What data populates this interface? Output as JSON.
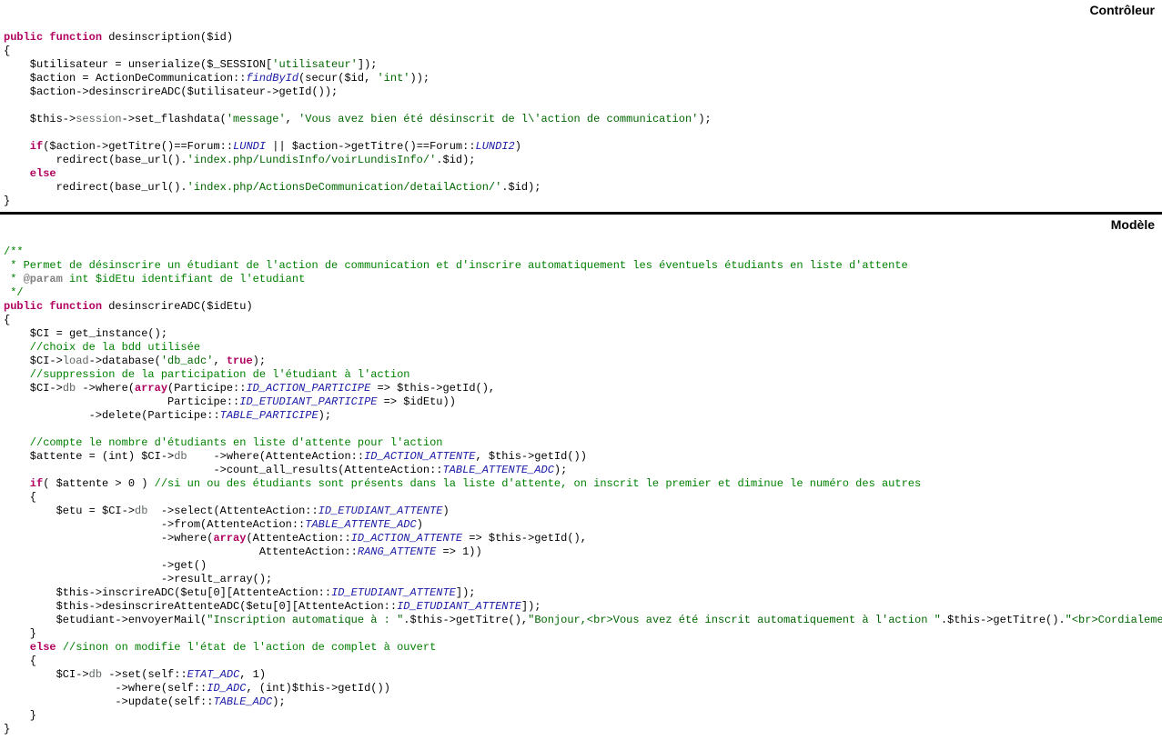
{
  "labels": {
    "controller": "Contrôleur",
    "model": "Modèle"
  },
  "controller": {
    "l01a": "public",
    "l01b": " function",
    "l01c": " desinscription($id)",
    "l02": "{",
    "l03a": "    $utilisateur = unserialize($_SESSION[",
    "l03b": "'utilisateur'",
    "l03c": "]);",
    "l04a": "    $action = ActionDeCommunication::",
    "l04b": "findById",
    "l04c": "(secur($id, ",
    "l04d": "'int'",
    "l04e": "));",
    "l05a": "    $action->desinscrireADC($utilisateur->getId());",
    "l06": "",
    "l07a": "    $this->",
    "l07b": "session",
    "l07c": "->set_flashdata(",
    "l07d": "'message'",
    "l07e": ", ",
    "l07f": "'Vous avez bien été désinscrit de l\\'action de communication'",
    "l07g": ");",
    "l08": "",
    "l09a": "    if",
    "l09b": "($action->getTitre()==Forum::",
    "l09c": "LUNDI",
    "l09d": " || $action->getTitre()==Forum::",
    "l09e": "LUNDI2",
    "l09f": ")",
    "l10a": "        redirect(base_url().",
    "l10b": "'index.php/LundisInfo/voirLundisInfo/'",
    "l10c": ".$id);",
    "l11a": "    else",
    "l12a": "        redirect(base_url().",
    "l12b": "'index.php/ActionsDeCommunication/detailAction/'",
    "l12c": ".$id);",
    "l13": "}"
  },
  "model": {
    "m01": "/**",
    "m02": " * Permet de désinscrire un étudiant de l'action de communication et d'inscrire automatiquement les éventuels étudiants en liste d'attente",
    "m03a": " * ",
    "m03b": "@param",
    "m03c": " int $idEtu identifiant de l'etudiant",
    "m04": " */",
    "m05a": "public",
    "m05b": " function",
    "m05c": " desinscrireADC($idEtu)",
    "m06": "{",
    "m07": "    $CI = get_instance();",
    "m08": "    //choix de la bdd utilisée",
    "m09a": "    $CI->",
    "m09b": "load",
    "m09c": "->database(",
    "m09d": "'db_adc'",
    "m09e": ", ",
    "m09f": "true",
    "m09g": ");",
    "m10": "    //suppression de la participation de l'étudiant à l'action",
    "m11a": "    $CI->",
    "m11b": "db",
    "m11c": " ->where(",
    "m11d": "array",
    "m11e": "(Participe::",
    "m11f": "ID_ACTION_PARTICIPE",
    "m11g": " => $this->getId(),",
    "m12a": "                         Participe::",
    "m12b": "ID_ETUDIANT_PARTICIPE",
    "m12c": " => $idEtu))",
    "m13a": "             ->delete(Participe::",
    "m13b": "TABLE_PARTICIPE",
    "m13c": ");",
    "m14": "",
    "m15": "    //compte le nombre d'étudiants en liste d'attente pour l'action",
    "m16a": "    $attente = (int) $CI->",
    "m16b": "db",
    "m16c": "    ->where(AttenteAction::",
    "m16d": "ID_ACTION_ATTENTE",
    "m16e": ", $this->getId())",
    "m17a": "                                ->count_all_results(AttenteAction::",
    "m17b": "TABLE_ATTENTE_ADC",
    "m17c": ");",
    "m18a": "    if",
    "m18b": "( $attente > 0 ) ",
    "m18c": "//si un ou des étudiants sont présents dans la liste d'attente, on inscrit le premier et diminue le numéro des autres",
    "m19": "    {",
    "m20a": "        $etu = $CI->",
    "m20b": "db",
    "m20c": "  ->select(AttenteAction::",
    "m20d": "ID_ETUDIANT_ATTENTE",
    "m20e": ")",
    "m21a": "                        ->from(AttenteAction::",
    "m21b": "TABLE_ATTENTE_ADC",
    "m21c": ")",
    "m22a": "                        ->where(",
    "m22b": "array",
    "m22c": "(AttenteAction::",
    "m22d": "ID_ACTION_ATTENTE",
    "m22e": " => $this->getId(),",
    "m23a": "                                       AttenteAction::",
    "m23b": "RANG_ATTENTE",
    "m23c": " => 1))",
    "m24": "                        ->get()",
    "m25": "                        ->result_array();",
    "m26a": "        $this->inscrireADC($etu[0][AttenteAction::",
    "m26b": "ID_ETUDIANT_ATTENTE",
    "m26c": "]);",
    "m27a": "        $this->desinscrireAttenteADC($etu[0][AttenteAction::",
    "m27b": "ID_ETUDIANT_ATTENTE",
    "m27c": "]);",
    "m28a": "        $etudiant->envoyerMail(",
    "m28b": "\"Inscription automatique à : \"",
    "m28c": ".$this->getTitre(),",
    "m28d": "\"Bonjour,<br>Vous avez été inscrit automatiquement à l'action \"",
    "m28e": ".$this->getTitre().",
    "m28f": "\"<br>Cordialement\"",
    "m28g": ");",
    "m29": "    }",
    "m30a": "    else",
    "m30b": " ",
    "m30c": "//sinon on modifie l'état de l'action de complet à ouvert",
    "m31": "    {",
    "m32a": "        $CI->",
    "m32b": "db",
    "m32c": " ->set(self::",
    "m32d": "ETAT_ADC",
    "m32e": ", 1)",
    "m33a": "                 ->where(self::",
    "m33b": "ID_ADC",
    "m33c": ", (int)$this->getId())",
    "m34a": "                 ->update(self::",
    "m34b": "TABLE_ADC",
    "m34c": ");",
    "m35": "    }",
    "m36": "}"
  }
}
